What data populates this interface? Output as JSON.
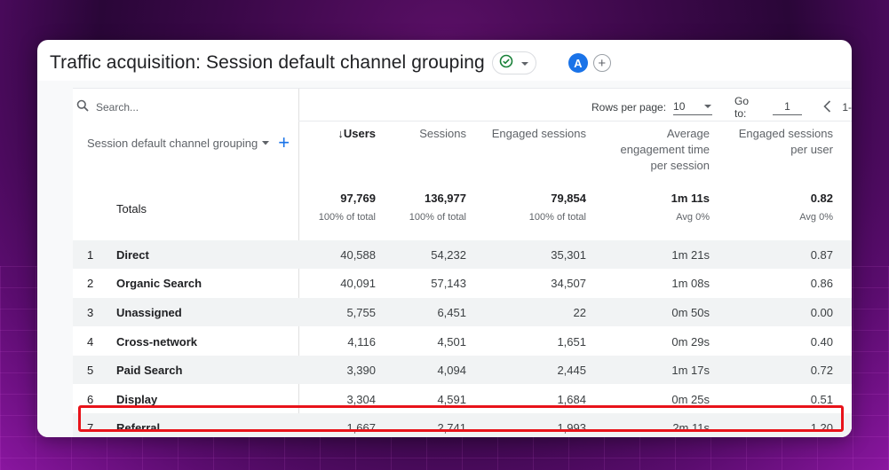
{
  "header": {
    "title": "Traffic acquisition: Session default channel grouping",
    "avatar_letter": "A"
  },
  "toolbar": {
    "search_placeholder": "Search...",
    "rows_per_page_label": "Rows per page:",
    "rows_per_page_value": "10",
    "goto_label": "Go to:",
    "goto_value": "1",
    "page_partial": "1-"
  },
  "table": {
    "dimension_header": "Session default channel grouping",
    "columns": [
      {
        "label": "Users",
        "sorted": true
      },
      {
        "label": "Sessions"
      },
      {
        "label": "Engaged sessions"
      },
      {
        "label_lines": [
          "Average",
          "engagement time",
          "per session"
        ]
      },
      {
        "label_lines": [
          "Engaged sessions",
          "per user"
        ]
      }
    ],
    "totals": {
      "label": "Totals",
      "values": [
        "97,769",
        "136,977",
        "79,854",
        "1m 11s",
        "0.82"
      ],
      "subs": [
        "100% of total",
        "100% of total",
        "100% of total",
        "Avg 0%",
        "Avg 0%"
      ]
    },
    "rows": [
      {
        "idx": "1",
        "name": "Direct",
        "values": [
          "40,588",
          "54,232",
          "35,301",
          "1m 21s",
          "0.87"
        ]
      },
      {
        "idx": "2",
        "name": "Organic Search",
        "values": [
          "40,091",
          "57,143",
          "34,507",
          "1m 08s",
          "0.86"
        ]
      },
      {
        "idx": "3",
        "name": "Unassigned",
        "values": [
          "5,755",
          "6,451",
          "22",
          "0m 50s",
          "0.00"
        ]
      },
      {
        "idx": "4",
        "name": "Cross-network",
        "values": [
          "4,116",
          "4,501",
          "1,651",
          "0m 29s",
          "0.40"
        ]
      },
      {
        "idx": "5",
        "name": "Paid Search",
        "values": [
          "3,390",
          "4,094",
          "2,445",
          "1m 17s",
          "0.72"
        ]
      },
      {
        "idx": "6",
        "name": "Display",
        "values": [
          "3,304",
          "4,591",
          "1,684",
          "0m 25s",
          "0.51"
        ]
      },
      {
        "idx": "7",
        "name": "Referral",
        "values": [
          "1,667",
          "2,741",
          "1,993",
          "2m 11s",
          "1.20"
        ]
      }
    ]
  },
  "colors": {
    "accent": "#1a73e8",
    "highlight": "#e8131a",
    "status_ok": "#188038"
  }
}
